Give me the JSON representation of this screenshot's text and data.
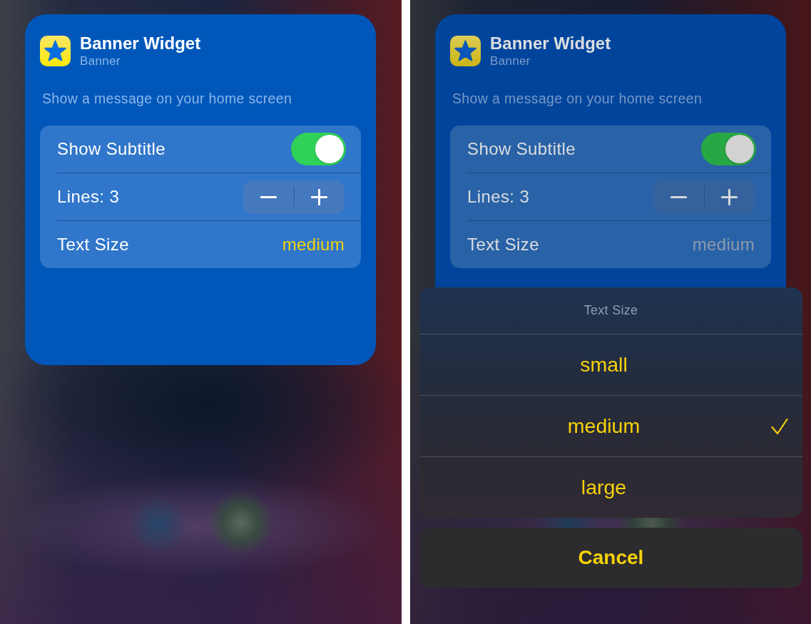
{
  "screens": [
    {
      "dimmed": false,
      "widget": {
        "title": "Banner Widget",
        "subtitle": "Banner",
        "description": "Show a message on your home screen",
        "settings": [
          {
            "kind": "toggle",
            "label": "Show Subtitle",
            "on": true
          },
          {
            "kind": "stepper",
            "label": "Lines: 3"
          },
          {
            "kind": "picker",
            "label": "Text Size",
            "value": "medium"
          }
        ]
      }
    },
    {
      "dimmed": true,
      "widget": {
        "title": "Banner Widget",
        "subtitle": "Banner",
        "description": "Show a message on your home screen",
        "settings": [
          {
            "kind": "toggle",
            "label": "Show Subtitle",
            "on": true
          },
          {
            "kind": "stepper",
            "label": "Lines: 3"
          },
          {
            "kind": "picker",
            "label": "Text Size",
            "value": "medium"
          }
        ]
      },
      "action_sheet": {
        "title": "Text Size",
        "options": [
          {
            "label": "small",
            "selected": false
          },
          {
            "label": "medium",
            "selected": true
          },
          {
            "label": "large",
            "selected": false
          }
        ],
        "cancel": "Cancel"
      }
    }
  ]
}
